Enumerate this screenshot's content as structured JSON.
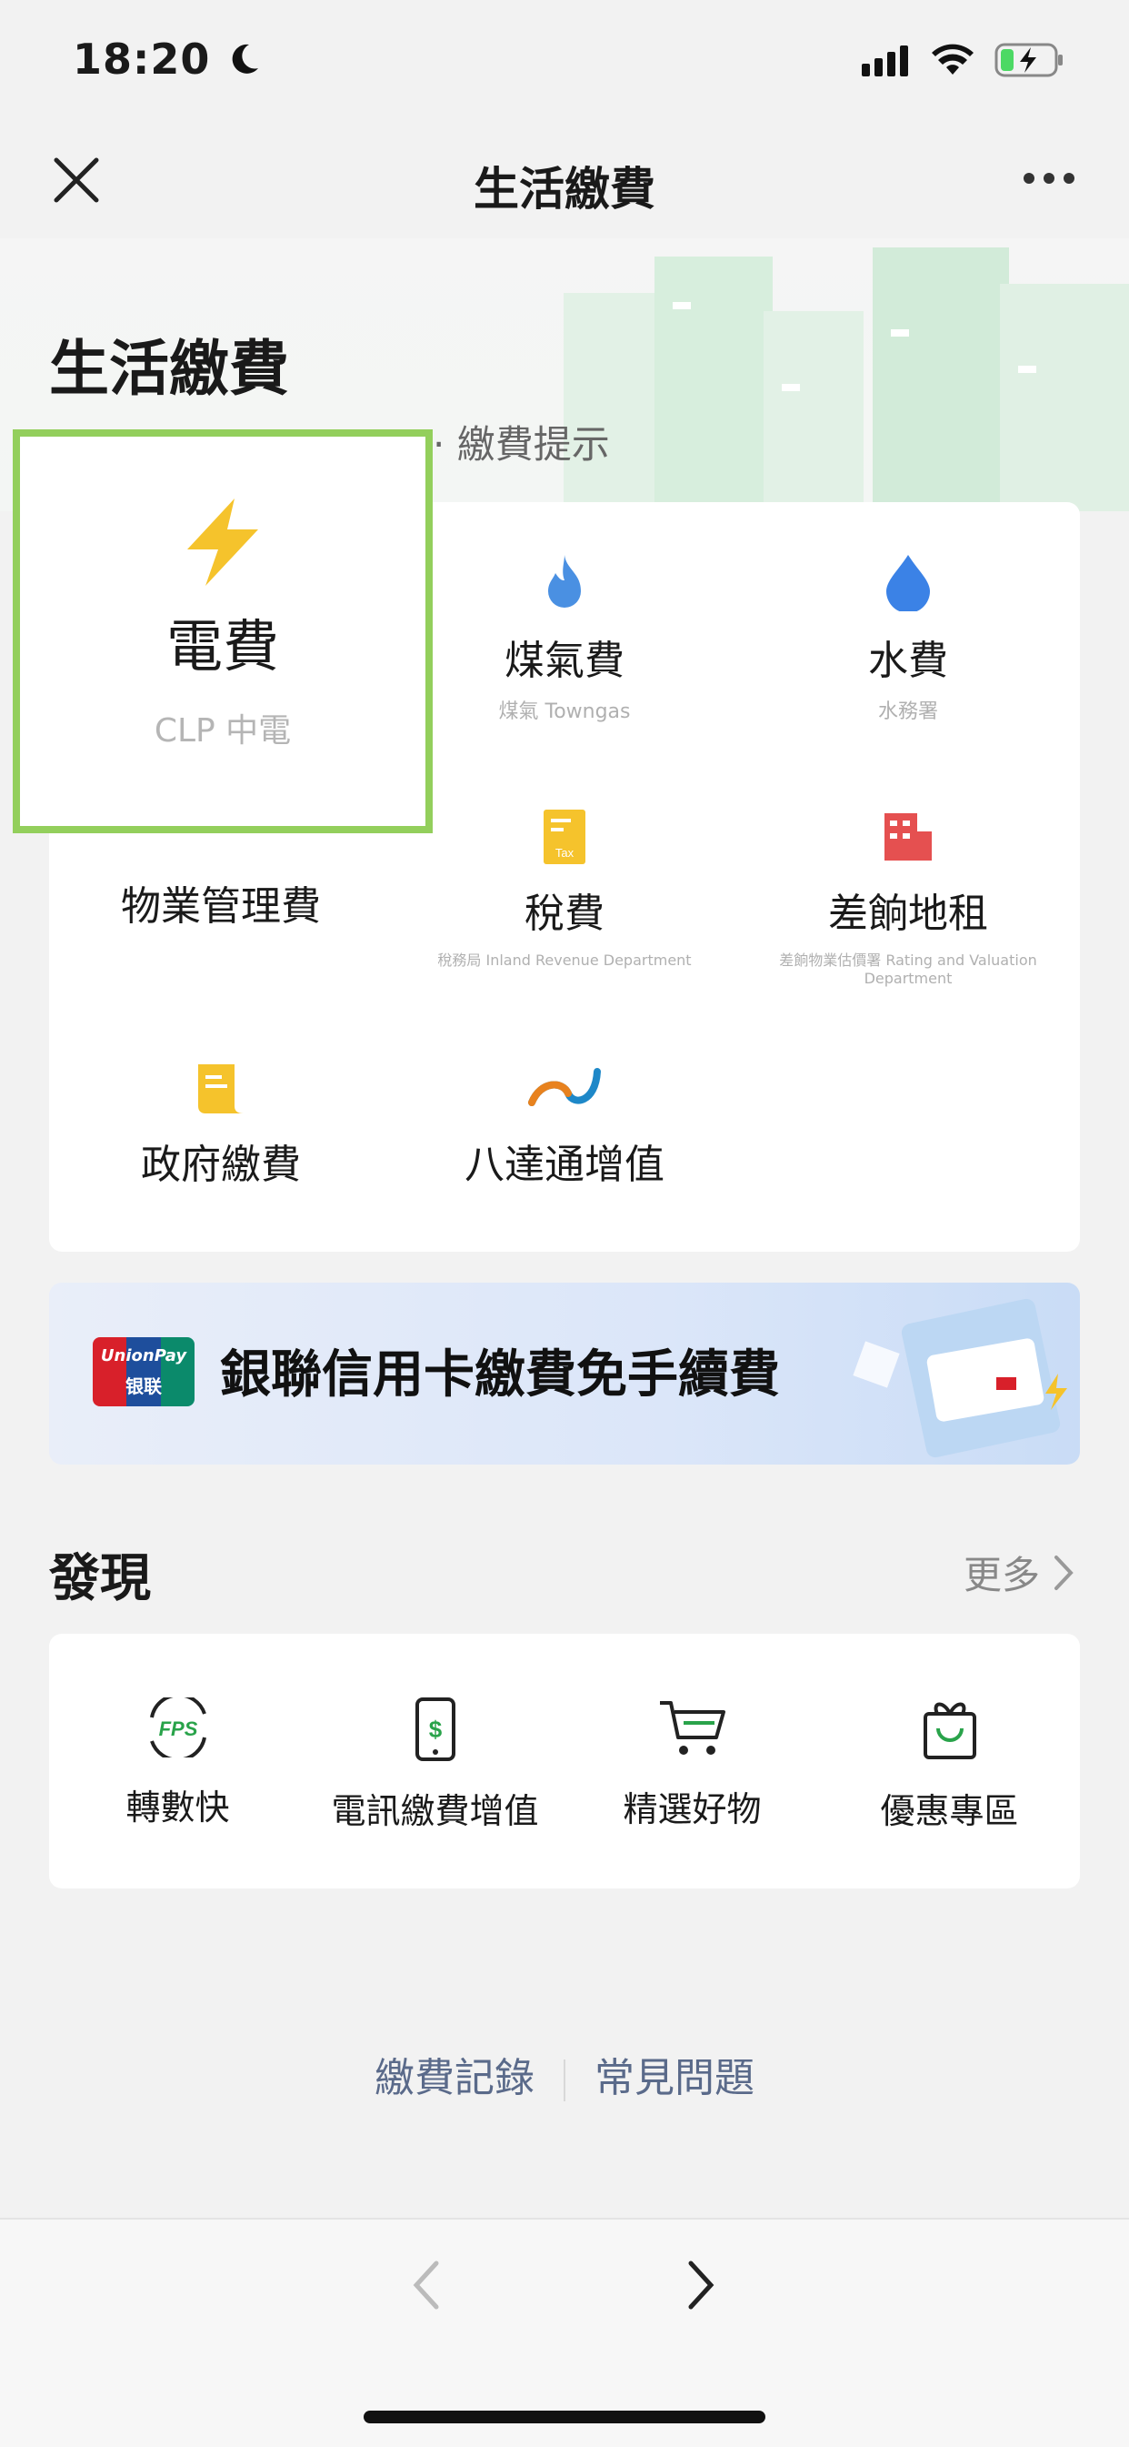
{
  "status": {
    "time": "18:20"
  },
  "nav": {
    "title": "生活繳費"
  },
  "header": {
    "title": "生活繳費",
    "subtitle_visible": "·  繳費提示"
  },
  "services": [
    {
      "label": "電費",
      "org": "CLP 中電",
      "icon": "lightning-icon",
      "color": "#f5c32c"
    },
    {
      "label": "煤氣費",
      "org": "煤氣 Towngas",
      "icon": "flame-icon",
      "color": "#4a90e2"
    },
    {
      "label": "水費",
      "org": "水務署",
      "icon": "water-drop-icon",
      "color": "#3b82e6"
    },
    {
      "label": "物業管理費",
      "org": "",
      "icon": "property-icon",
      "color": "#e55050"
    },
    {
      "label": "稅費",
      "org": "稅務局 Inland Revenue Department",
      "icon": "tax-icon",
      "color": "#f5c32c"
    },
    {
      "label": "差餉地租",
      "org": "差餉物業估價署 Rating and Valuation Department",
      "icon": "building-icon",
      "color": "#e55050"
    },
    {
      "label": "政府繳費",
      "org": "",
      "icon": "document-icon",
      "color": "#f5c32c"
    },
    {
      "label": "八達通增值",
      "org": "",
      "icon": "octopus-icon",
      "color": "#e8821e"
    }
  ],
  "banner": {
    "text": "銀聯信用卡繳費免手續費",
    "logo_top": "UnionPay",
    "logo_bottom": "银联"
  },
  "discover": {
    "title": "發現",
    "more": "更多",
    "items": [
      {
        "label": "轉數快",
        "icon": "fps-icon"
      },
      {
        "label": "電訊繳費增值",
        "icon": "phone-dollar-icon"
      },
      {
        "label": "精選好物",
        "icon": "cart-icon"
      },
      {
        "label": "優惠專區",
        "icon": "gift-bag-icon"
      }
    ]
  },
  "footer": {
    "records": "繳費記錄",
    "faq": "常見問題"
  }
}
